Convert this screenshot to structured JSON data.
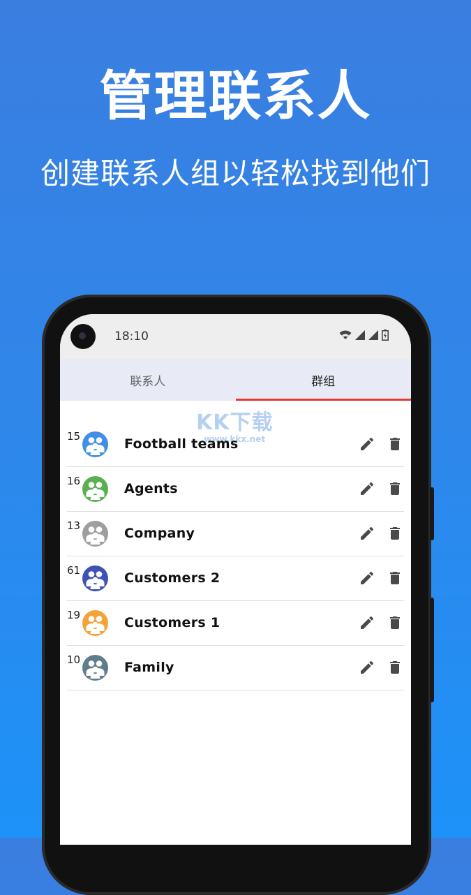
{
  "headline": "管理联系人",
  "subline": "创建联系人组以轻松找到他们",
  "watermark": {
    "main": "KK下载",
    "sub": "www.kkx.net"
  },
  "status_bar": {
    "time": "18:10"
  },
  "tabs": [
    {
      "label": "联系人",
      "active": false
    },
    {
      "label": "群组",
      "active": true
    }
  ],
  "accent_color": "#e53935",
  "groups": [
    {
      "count": "15",
      "name": "Football teams",
      "color": "#3f8fe6"
    },
    {
      "count": "16",
      "name": "Agents",
      "color": "#5aaf50"
    },
    {
      "count": "13",
      "name": "Company",
      "color": "#9e9e9e"
    },
    {
      "count": "61",
      "name": "Customers 2",
      "color": "#3f51b5"
    },
    {
      "count": "19",
      "name": "Customers 1",
      "color": "#f3a33a"
    },
    {
      "count": "10",
      "name": "Family",
      "color": "#607d8b"
    }
  ]
}
